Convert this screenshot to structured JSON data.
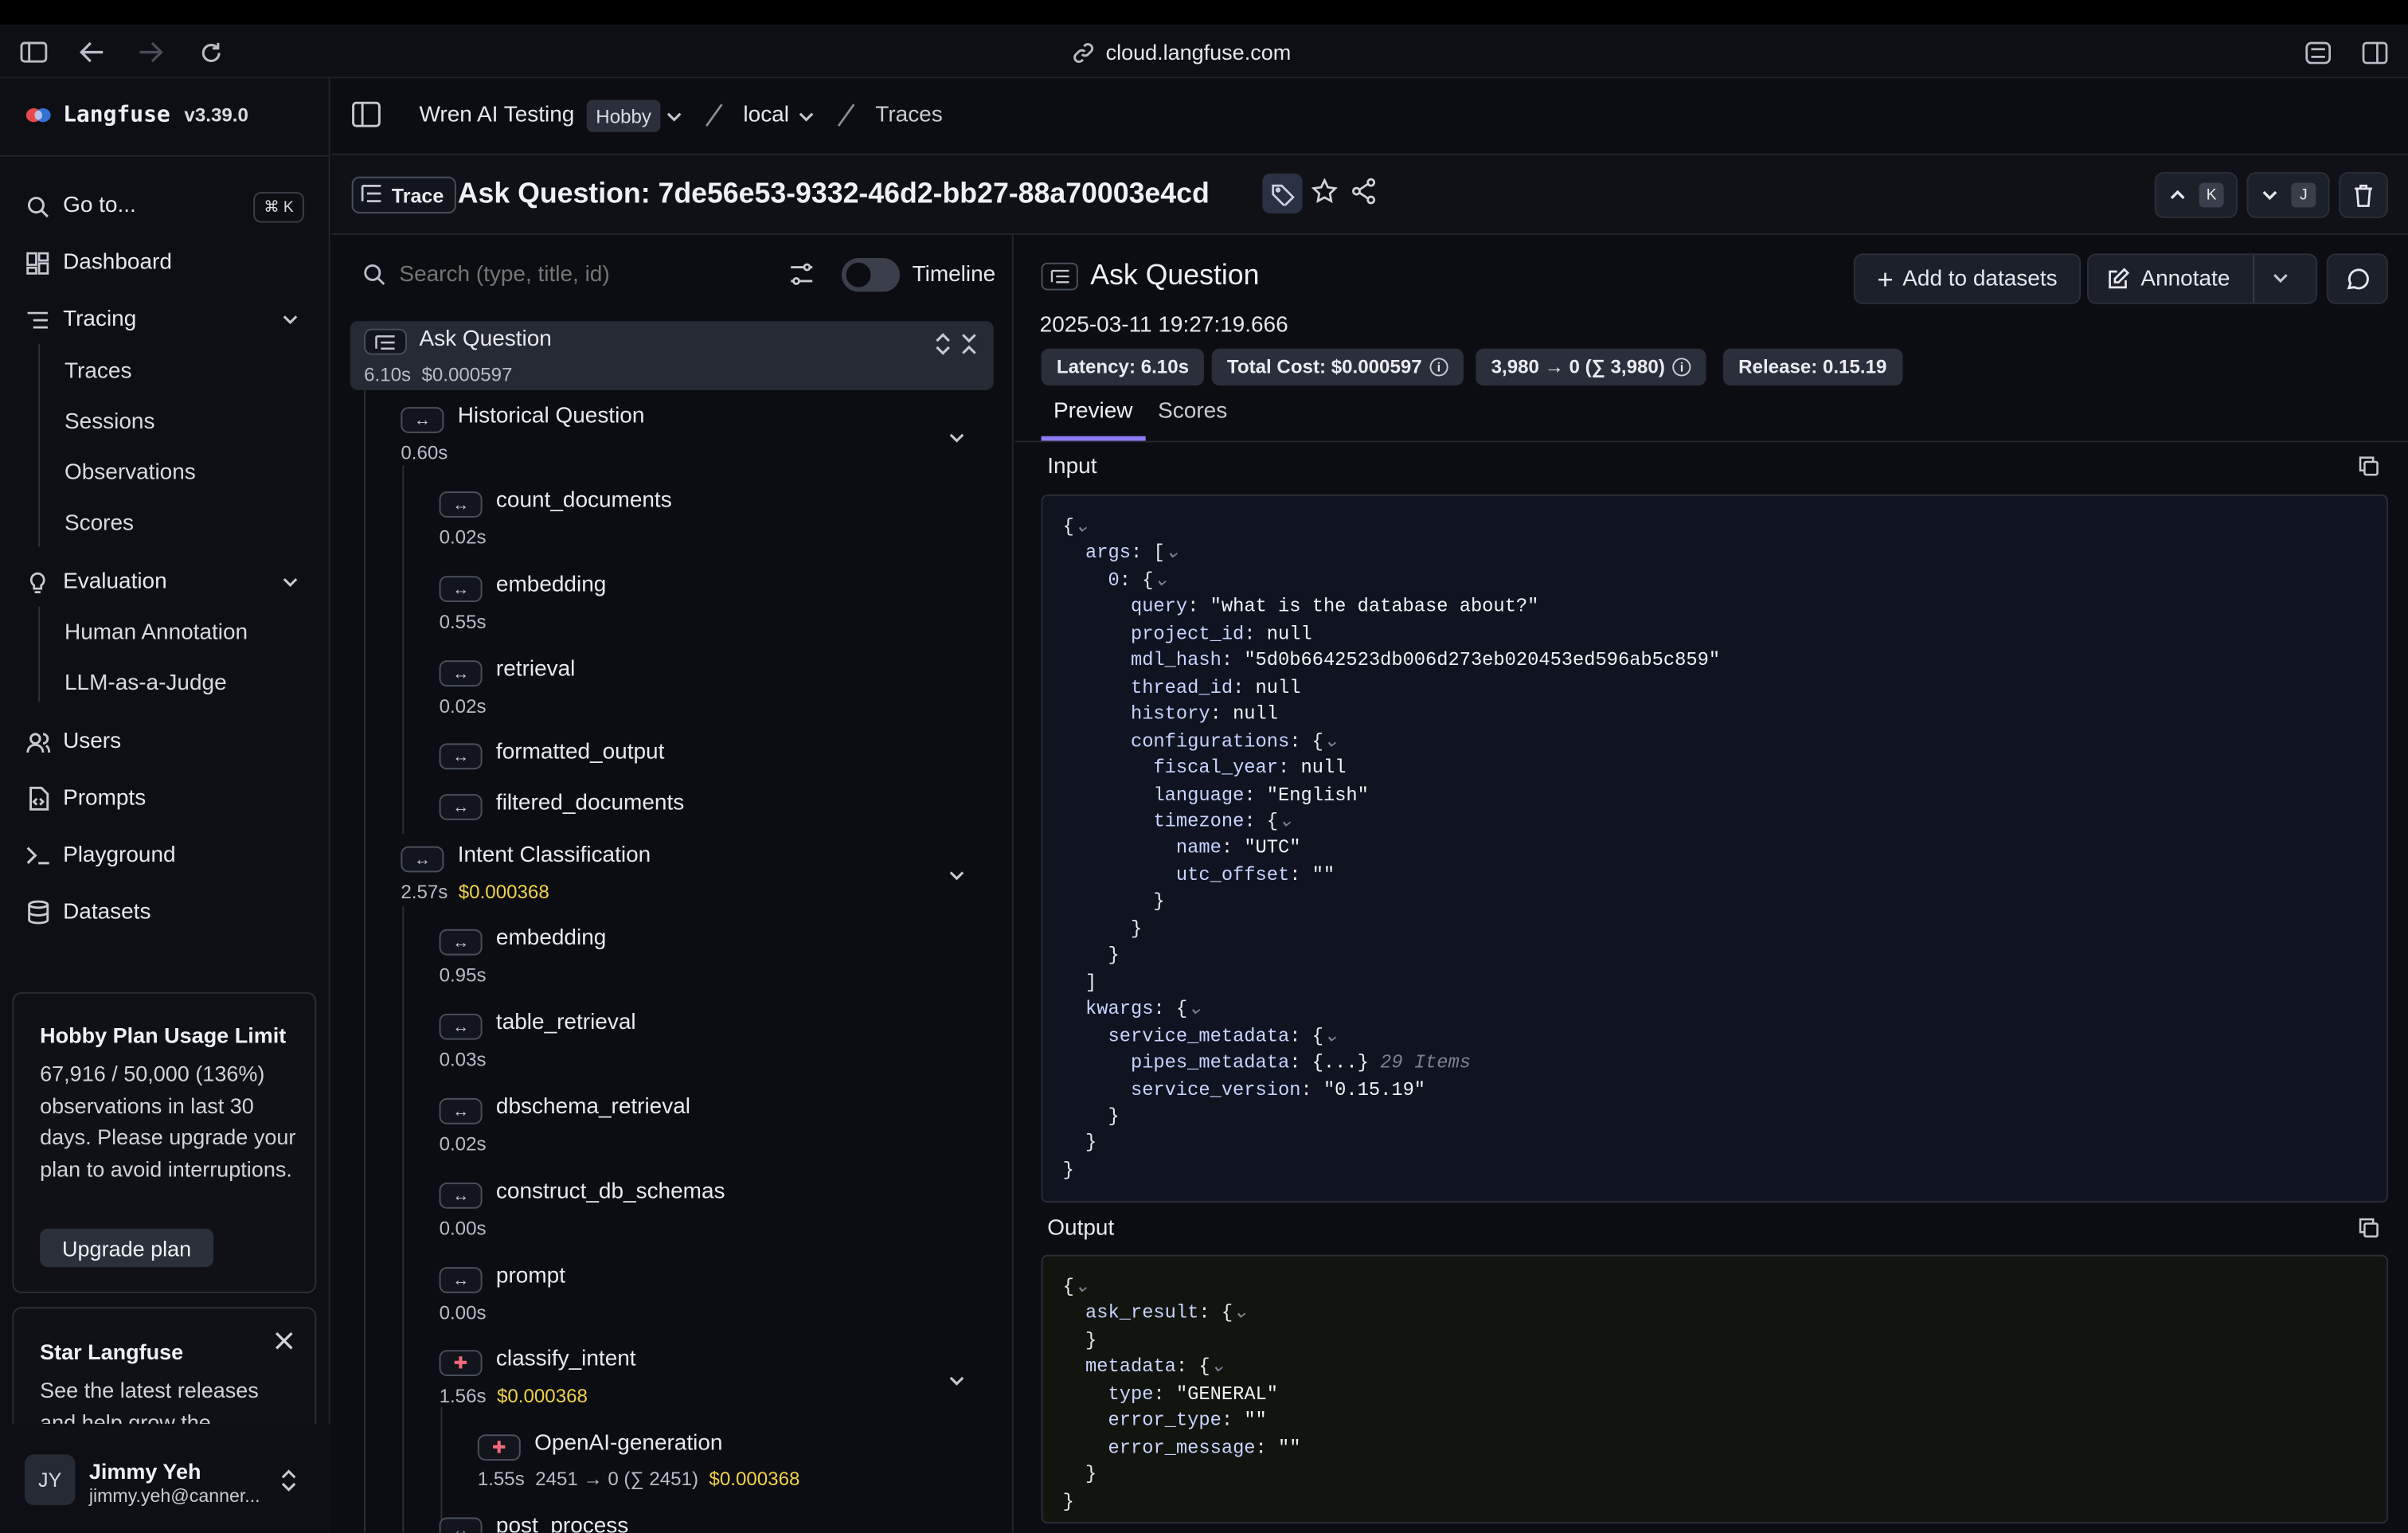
{
  "browser": {
    "url": "cloud.langfuse.com"
  },
  "app": {
    "name": "Langfuse",
    "version": "v3.39.0"
  },
  "sidebar": {
    "goto_label": "Go to...",
    "goto_shortcut": "⌘ K",
    "items": {
      "dashboard": "Dashboard",
      "tracing": "Tracing",
      "traces": "Traces",
      "sessions": "Sessions",
      "observations": "Observations",
      "scores": "Scores",
      "evaluation": "Evaluation",
      "human_annotation": "Human Annotation",
      "llm_judge": "LLM-as-a-Judge",
      "users": "Users",
      "prompts": "Prompts",
      "playground": "Playground",
      "datasets": "Datasets"
    },
    "usage_card": {
      "title": "Hobby Plan Usage Limit",
      "body": "67,916 / 50,000 (136%) observations in last 30 days. Please upgrade your plan to avoid interruptions.",
      "button": "Upgrade plan"
    },
    "star_card": {
      "title": "Star Langfuse",
      "body": "See the latest releases and help grow the"
    },
    "user": {
      "initials": "JY",
      "name": "Jimmy Yeh",
      "email": "jimmy.yeh@canner..."
    }
  },
  "breadcrumb": {
    "project": "Wren AI Testing",
    "plan_badge": "Hobby",
    "env": "local",
    "page": "Traces"
  },
  "trace": {
    "badge": "Trace",
    "title": "Ask Question: 7de56e53-9332-46d2-bb27-88a70003e4cd",
    "nav_prev_key": "K",
    "nav_next_key": "J"
  },
  "tree": {
    "search_placeholder": "Search (type, title, id)",
    "timeline_label": "Timeline",
    "root": {
      "name": "Ask Question",
      "duration": "6.10s",
      "cost": "$0.000597"
    },
    "nodes": [
      {
        "name": "Historical Question",
        "duration": "0.60s",
        "cost": ""
      },
      {
        "name": "count_documents",
        "duration": "0.02s",
        "cost": ""
      },
      {
        "name": "embedding",
        "duration": "0.55s",
        "cost": ""
      },
      {
        "name": "retrieval",
        "duration": "0.02s",
        "cost": ""
      },
      {
        "name": "formatted_output",
        "duration": "",
        "cost": ""
      },
      {
        "name": "filtered_documents",
        "duration": "",
        "cost": ""
      },
      {
        "name": "Intent Classification",
        "duration": "2.57s",
        "cost": "$0.000368"
      },
      {
        "name": "embedding",
        "duration": "0.95s",
        "cost": ""
      },
      {
        "name": "table_retrieval",
        "duration": "0.03s",
        "cost": ""
      },
      {
        "name": "dbschema_retrieval",
        "duration": "0.02s",
        "cost": ""
      },
      {
        "name": "construct_db_schemas",
        "duration": "0.00s",
        "cost": ""
      },
      {
        "name": "prompt",
        "duration": "0.00s",
        "cost": ""
      },
      {
        "name": "classify_intent",
        "duration": "1.56s",
        "cost": "$0.000368"
      },
      {
        "name": "OpenAI-generation",
        "duration": "1.55s",
        "tokens": "2451 → 0 (∑ 2451)",
        "cost": "$0.000368"
      },
      {
        "name": "post_process",
        "duration": "",
        "cost": ""
      }
    ]
  },
  "detail": {
    "title": "Ask Question",
    "timestamp": "2025-03-11 19:27:19.666",
    "add_to_datasets": "Add to datasets",
    "annotate": "Annotate",
    "pills": {
      "latency": "Latency: 6.10s",
      "cost": "Total Cost: $0.000597",
      "tokens": "3,980 → 0 (∑ 3,980)",
      "release": "Release: 0.15.19"
    },
    "tabs": {
      "preview": "Preview",
      "scores": "Scores"
    },
    "input_label": "Input",
    "output_label": "Output",
    "input_json": {
      "query": "\"what is the database about?\"",
      "project_id": "null",
      "mdl_hash": "\"5d0b6642523db006d273eb020453ed596ab5c859\"",
      "thread_id": "null",
      "history": "null",
      "fiscal_year": "null",
      "language": "\"English\"",
      "tz_name": "\"UTC\"",
      "utc_offset": "\"\"",
      "pipes_metadata": "{...}",
      "pipes_items": "29 Items",
      "service_version": "\"0.15.19\""
    },
    "output_json": {
      "type": "\"GENERAL\"",
      "error_type": "\"\"",
      "error_message": "\"\""
    }
  },
  "colors": {
    "accent": "#8b7cf6",
    "cost": "#f2d24a",
    "brand": "#e5484d"
  }
}
